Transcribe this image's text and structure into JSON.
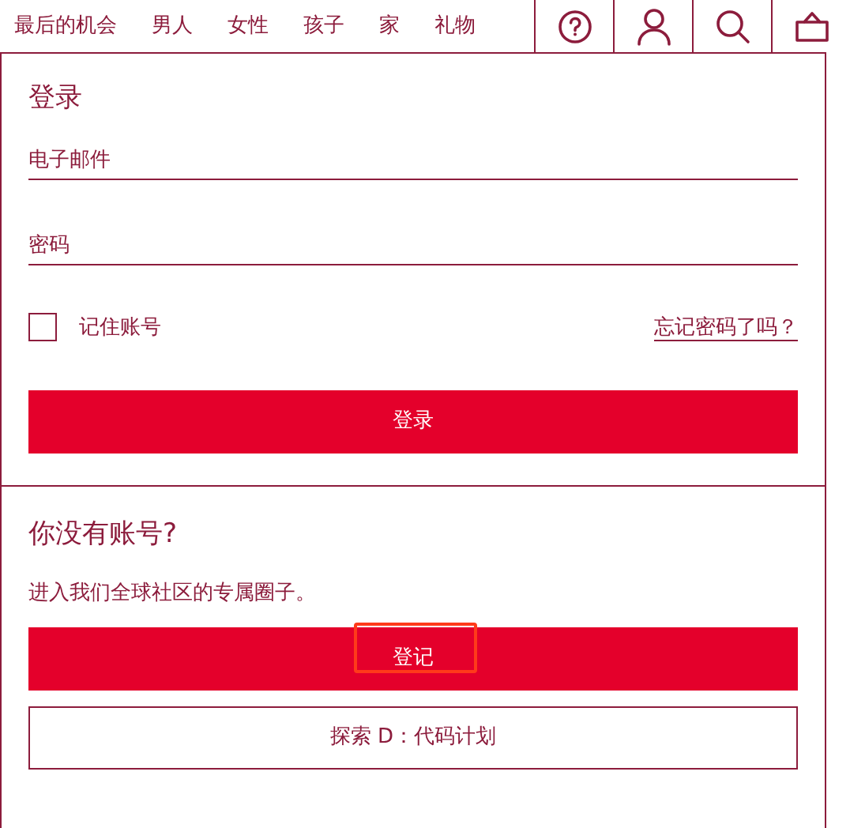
{
  "nav": {
    "links": [
      "最后的机会",
      "男人",
      "女性",
      "孩子",
      "家",
      "礼物"
    ],
    "icons": [
      {
        "kind": "help"
      },
      {
        "kind": "account"
      },
      {
        "kind": "search"
      },
      {
        "kind": "basket"
      }
    ]
  },
  "login": {
    "title": "登录",
    "fields": [
      {
        "placeholder": "电子邮件"
      },
      {
        "placeholder": "密码"
      }
    ],
    "remember": {
      "label": "记住账号",
      "checked": false
    },
    "forgot_link": "忘记密码了吗？",
    "submit_button": "登录"
  },
  "register": {
    "title": "你没有账号?",
    "text": "进入我们全球社区的专属圈子。",
    "register_button": {
      "label": "登记",
      "highlighted": true
    },
    "explore_button": "探索 D：代码计划"
  }
}
